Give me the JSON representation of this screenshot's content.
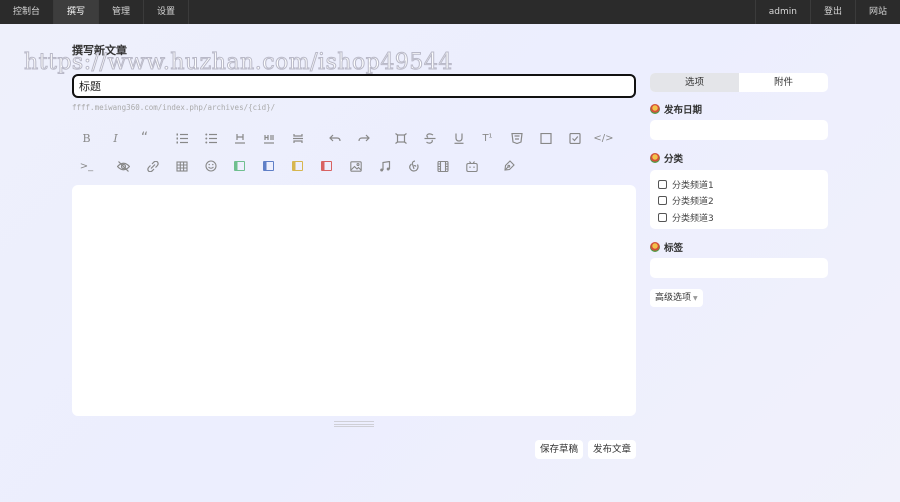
{
  "nav": {
    "left": [
      "控制台",
      "撰写",
      "管理",
      "设置"
    ],
    "right": [
      "admin",
      "登出",
      "网站"
    ]
  },
  "page_title": "撰写新文章",
  "watermark": "https://www.huzhan.com/ishop49544",
  "title_input": {
    "value": "标题"
  },
  "url_hint": "ffff.meiwang360.com/index.php/archives/{cid}/",
  "toolbar": {
    "bold": "B",
    "italic": "I",
    "quote": "“",
    "superscript": "T¹",
    "code": "</>",
    "terminal": ">_"
  },
  "actions": {
    "save_draft": "保存草稿",
    "publish": "发布文章"
  },
  "sidebar": {
    "tabs": [
      "选项",
      "附件"
    ],
    "publish_date_label": "发布日期",
    "category_label": "分类",
    "categories": [
      "分类频道1",
      "分类频道2",
      "分类频道3"
    ],
    "tags_label": "标签",
    "advanced_label": "高级选项"
  }
}
